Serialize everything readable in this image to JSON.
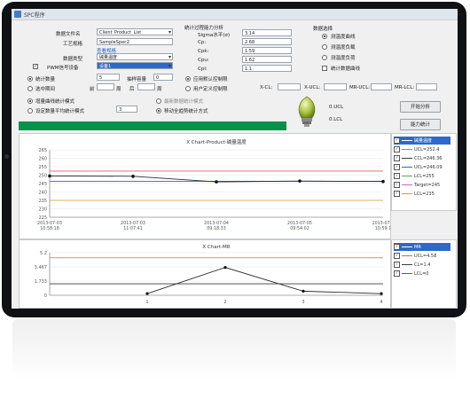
{
  "window": {
    "title": "SPC程序"
  },
  "form": {
    "file_label": "数据文件名",
    "file_value": "Client_Product_List",
    "process_label": "工艺规格",
    "process_value": "SampleSpec2",
    "spec_link": "查看规格",
    "data_type_label": "数据类型",
    "data_type_value": "碱量温度",
    "device_label": "PWM信号设备",
    "device_value": "设备1",
    "device_checked": true
  },
  "capability": {
    "header": "统计过程能力分析",
    "rows": [
      {
        "label": "Sigma水平(σ)",
        "value": "3.14"
      },
      {
        "label": "Cp:",
        "value": "2.68"
      },
      {
        "label": "Cpk:",
        "value": "1.59"
      },
      {
        "label": "Cpu:",
        "value": "1.62"
      },
      {
        "label": "Cpl:",
        "value": "1.1"
      }
    ]
  },
  "options": {
    "header": "数据选择",
    "items": [
      {
        "label": "测温度曲线",
        "checked": true
      },
      {
        "label": "测温度负载",
        "checked": false
      },
      {
        "label": "测温度负荷",
        "checked": false
      },
      {
        "label": "统计数据曲线",
        "checked": false
      }
    ]
  },
  "stats": {
    "count_label": "统计数量",
    "count_value": "5",
    "group_label": "抽样容量",
    "group_value": "0",
    "period_label": "选中期间",
    "from_label": "前",
    "week_label": "周",
    "to_label": "后",
    "week2_label": "周"
  },
  "limits": {
    "auto_label": "应用默认控制限",
    "custom_label": "用户定义控制限",
    "ucl_label": "X-CL:",
    "xucl_label": "X-UCL:",
    "mrucl_label": "MR-UCL:",
    "mrlcl_label": "MR-LCL:"
  },
  "modes": {
    "mode1": "增量曲线统计模式",
    "mode2": "设定数量平均统计模式",
    "mode2_value": "3",
    "mode3": "最新数据统计模式",
    "mode4": "移动全趋势统计方式"
  },
  "indicator": {
    "ucl_label": "0.UCL",
    "lcl_label": "0.LCL"
  },
  "buttons": {
    "start": "开始分析",
    "chart": "能力统计"
  },
  "chart1": {
    "title": "X Chart-Product-碱量温度",
    "y_ticks": [
      "265",
      "260",
      "255",
      "250",
      "245",
      "240",
      "235",
      "230",
      "225"
    ],
    "x_ticks": [
      {
        "date": "2013-07-03",
        "time": "10:58:18"
      },
      {
        "date": "2013-07-03",
        "time": "11:07:41"
      },
      {
        "date": "2013-07-04",
        "time": "09:18:33"
      },
      {
        "date": "2013-07-05",
        "time": "09:54:02"
      },
      {
        "date": "2013-07-0",
        "time": "10:59:1"
      }
    ]
  },
  "chart2": {
    "title": "X Chart-MR",
    "y_ticks": [
      "5.2",
      "3.467",
      "1.733",
      "0"
    ],
    "x_ticks": [
      "1",
      "2",
      "3",
      "4"
    ]
  },
  "legend1": {
    "items": [
      {
        "label": "碱量温度",
        "color": "#2f68c8",
        "highlight": true
      },
      {
        "label": "UCL=252.4",
        "color": "#e06060"
      },
      {
        "label": "CCL=246.36",
        "color": "#3a3a3a"
      },
      {
        "label": "UCL=246.09",
        "color": "#3060d0"
      },
      {
        "label": "LCL=255",
        "color": "#60a060"
      },
      {
        "label": "Target=245",
        "color": "#d060d0"
      },
      {
        "label": "LCL=235",
        "color": "#e09040"
      }
    ]
  },
  "legend2": {
    "items": [
      {
        "label": "MR",
        "highlight": true
      },
      {
        "label": "UCL=4.58",
        "color": "#e06060"
      },
      {
        "label": "CL=1.4",
        "color": "#3a3a3a"
      },
      {
        "label": "LCL=0",
        "color": "#3060d0"
      }
    ]
  },
  "chart_data": [
    {
      "type": "line",
      "title": "X Chart-Product-碱量温度",
      "ylim": [
        225,
        265
      ],
      "categories": [
        "2013-07-03 10:58:18",
        "2013-07-03 11:07:41",
        "2013-07-04 09:18:33",
        "2013-07-05 09:54:02",
        "2013-07-0 10:59:1"
      ],
      "series": [
        {
          "name": "碱量温度",
          "values": [
            249.5,
            249.3,
            246,
            246.5,
            246.2
          ]
        },
        {
          "name": "UCL=252.4",
          "values": [
            252.4,
            252.4,
            252.4,
            252.4,
            252.4
          ]
        },
        {
          "name": "CCL=246.36",
          "values": [
            246.36,
            246.36,
            246.36,
            246.36,
            246.36
          ]
        },
        {
          "name": "LCL=235",
          "values": [
            235,
            235,
            235,
            235,
            235
          ]
        }
      ]
    },
    {
      "type": "line",
      "title": "X Chart-MR",
      "ylim": [
        0,
        5.2
      ],
      "categories": [
        "1",
        "2",
        "3",
        "4"
      ],
      "series": [
        {
          "name": "MR",
          "values": [
            0.2,
            3.4,
            0.5,
            0.2
          ]
        },
        {
          "name": "UCL=4.58",
          "values": [
            4.58,
            4.58,
            4.58,
            4.58
          ]
        },
        {
          "name": "CL=1.4",
          "values": [
            1.4,
            1.4,
            1.4,
            1.4
          ]
        }
      ]
    }
  ]
}
